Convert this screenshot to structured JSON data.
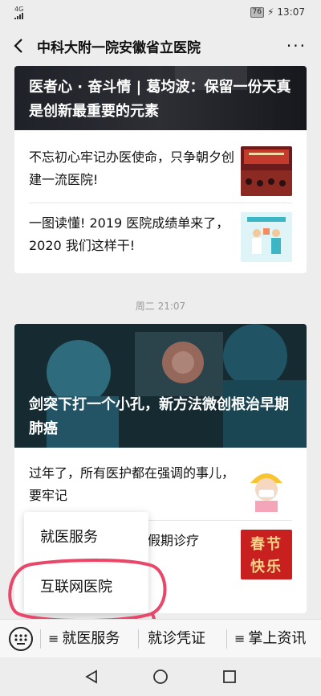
{
  "status": {
    "signal": "4G",
    "battery": "76",
    "time": "13:07"
  },
  "nav": {
    "title": "中科大附一院安徽省立医院",
    "more": "···"
  },
  "card1": {
    "hero_title": "医者心 · 奋斗情 | 葛均波：保留一份天真是创新最重要的元素",
    "items": [
      {
        "text": "不忘初心牢记办医使命，只争朝夕创建一流医院!"
      },
      {
        "text": "一图读懂! 2019 医院成绩单来了，2020 我们这样干!"
      }
    ]
  },
  "timestamp": "周二 21:07",
  "card2": {
    "hero_title": "剑突下打一个小孔，新方法微创根治早期肺癌",
    "items": [
      {
        "text": "过年了，所有医护都在强调的事儿，要牢记"
      },
      {
        "text": "节假期诊疗",
        "thumb_text_1": "春节",
        "thumb_text_2": "快乐"
      }
    ]
  },
  "popup": {
    "items": [
      "就医服务",
      "互联网医院"
    ]
  },
  "menubar": {
    "items": [
      "就医服务",
      "就诊凭证",
      "掌上资讯"
    ],
    "menu_glyph": "≡"
  },
  "colors": {
    "annotation": "#e8476a",
    "menu_bg": "#f7f7f7",
    "page_bg": "#ededed"
  }
}
